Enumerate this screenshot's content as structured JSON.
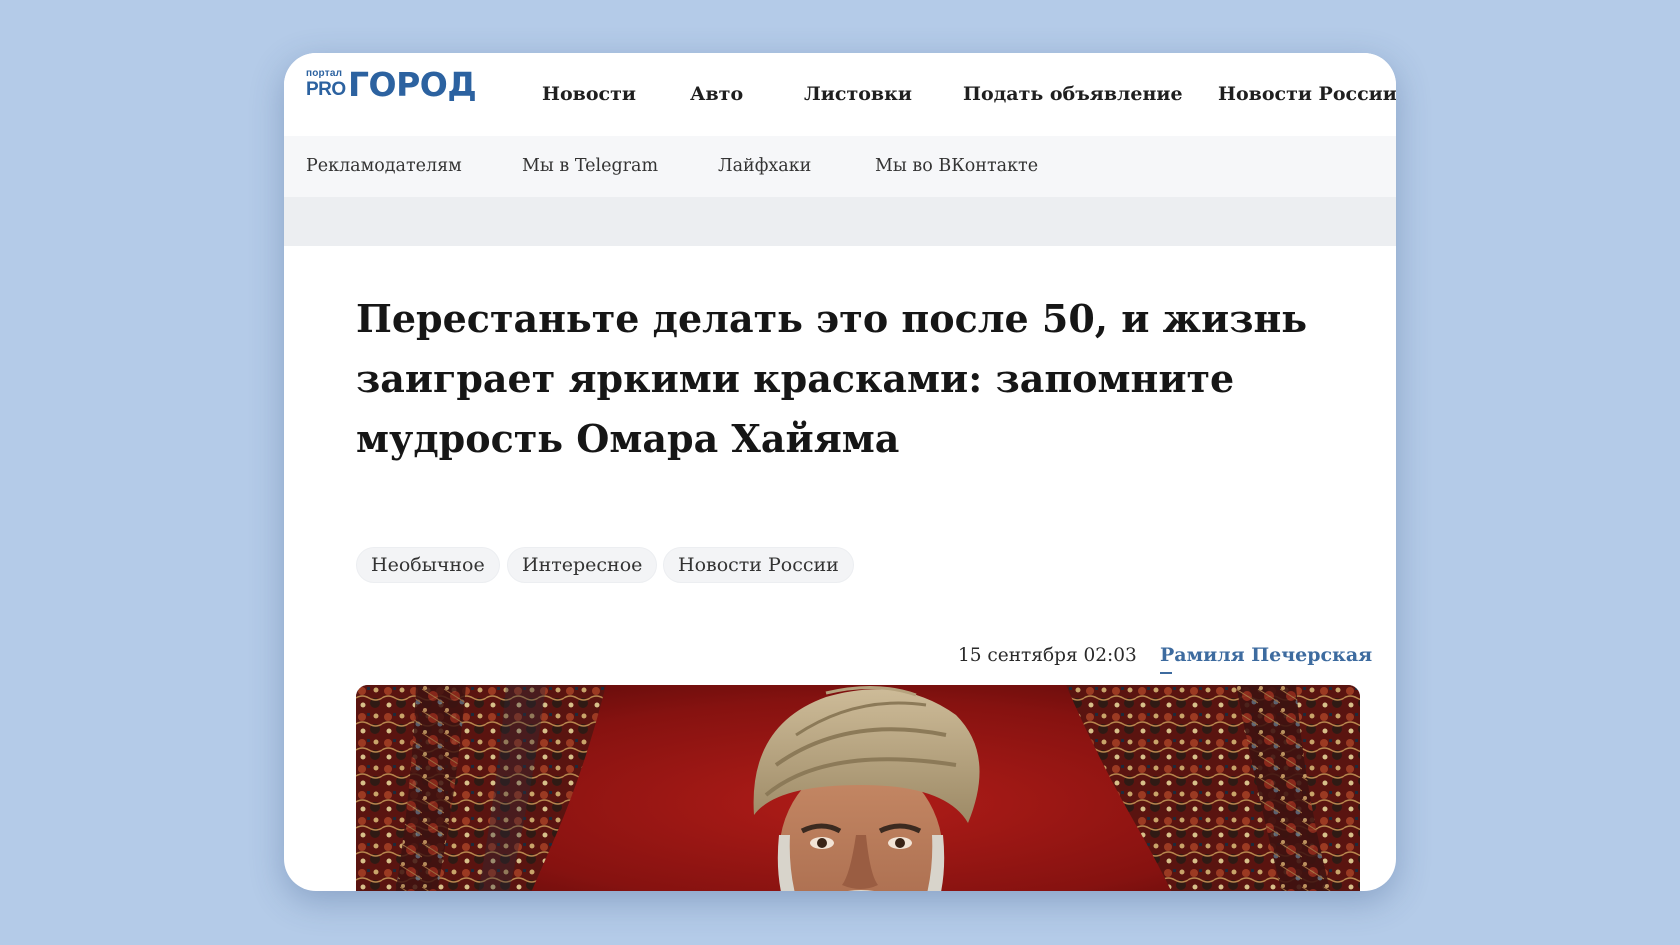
{
  "logo": {
    "small_text": "портал",
    "pro_text": "PRO",
    "main_text": "ГОРОД",
    "color": "#2c62a0"
  },
  "top_nav": {
    "items": [
      {
        "label": "Новости"
      },
      {
        "label": "Авто"
      },
      {
        "label": "Листовки"
      },
      {
        "label": "Подать объявление"
      },
      {
        "label": "Новости России"
      }
    ]
  },
  "sub_nav": {
    "items": [
      {
        "label": "Рекламодателям"
      },
      {
        "label": "Мы в Telegram"
      },
      {
        "label": "Лайфхаки"
      },
      {
        "label": "Мы во ВКонтакте"
      }
    ]
  },
  "article": {
    "title": "Перестаньте делать это после 50, и жизнь заиграет яркими красками: запомните мудрость Омара Хайяма",
    "tags": [
      {
        "label": "Необычное"
      },
      {
        "label": "Интересное"
      },
      {
        "label": "Новости России"
      }
    ],
    "date": "15 сентября 02:03",
    "author": "Рамиля Печерская",
    "author_color": "#3d6b9f"
  },
  "colors": {
    "background": "#b4cbe8",
    "card": "#ffffff",
    "subnav_bg": "#f6f7f9"
  }
}
